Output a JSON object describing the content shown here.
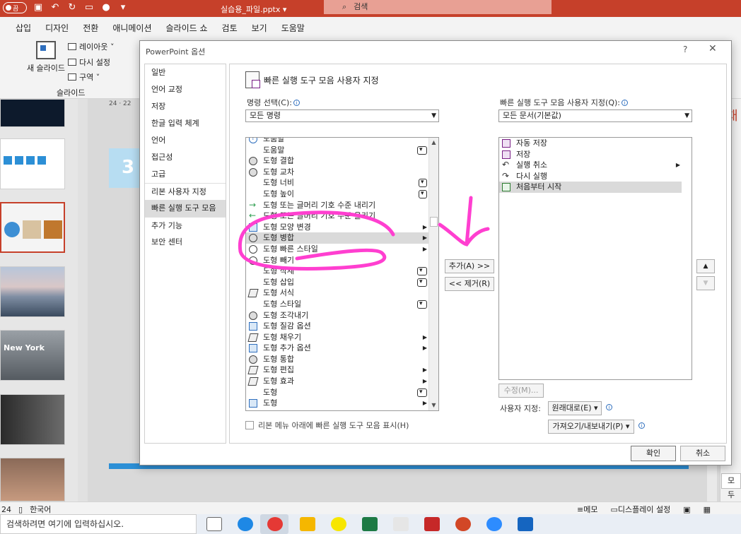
{
  "titlebar": {
    "autosave_label": "끔",
    "filename": "실습용_파일.pptx ▾",
    "search_placeholder": "검색"
  },
  "menu_tabs": [
    "삽입",
    "디자인",
    "전환",
    "애니메이션",
    "슬라이드 쇼",
    "검토",
    "보기",
    "도움말"
  ],
  "ribbon": {
    "new_slide": "새 슬라이드",
    "layout": "레이아웃 ˅",
    "reset": "다시 설정",
    "section": "구역 ˅",
    "group_label": "슬라이드"
  },
  "ruler_label": "24 · 22",
  "slide_partial_text": "3",
  "thumb_city_text": "New York",
  "right_pane_text": "채",
  "right_pane_button": "모두",
  "status": {
    "slide_num": "24",
    "language": "한국어",
    "notes": "메모",
    "display": "디스플레이 설정"
  },
  "taskbar": {
    "search_placeholder": "검색하려면 여기에 입력하십시오."
  },
  "dialog": {
    "title": "PowerPoint 옵션",
    "help": "?",
    "close": "✕",
    "nav_items": [
      {
        "label": "일반",
        "active": false
      },
      {
        "label": "언어 교정",
        "active": false
      },
      {
        "label": "저장",
        "active": false
      },
      {
        "label": "한글 입력 체계",
        "active": false
      },
      {
        "label": "언어",
        "active": false
      },
      {
        "label": "접근성",
        "active": false
      },
      {
        "label": "고급",
        "active": false
      },
      {
        "label": "리본 사용자 지정",
        "active": false
      },
      {
        "label": "빠른 실행 도구 모음",
        "active": true
      },
      {
        "label": "추가 기능",
        "active": false
      },
      {
        "label": "보안 센터",
        "active": false
      }
    ],
    "heading": "빠른 실행 도구 모음 사용자 지정",
    "choose_label": "명령 선택(C):",
    "choose_value": "모든 명령",
    "customize_label": "빠른 실행 도구 모음 사용자 지정(Q):",
    "customize_value": "모든 문서(기본값)",
    "commands": [
      {
        "label": "도움말",
        "icon": "question-icon",
        "tail": ""
      },
      {
        "label": "도움말",
        "icon": "",
        "tail": "opt"
      },
      {
        "label": "도형 결합",
        "icon": "combine-shapes-icon",
        "tail": ""
      },
      {
        "label": "도형 교차",
        "icon": "intersect-shapes-icon",
        "tail": ""
      },
      {
        "label": "도형 너비",
        "icon": "",
        "tail": "spin"
      },
      {
        "label": "도형 높이",
        "icon": "",
        "tail": "spin"
      },
      {
        "label": "도형 또는 글머리 기호 수준 내리기",
        "icon": "demote-arrow-icon",
        "tail": ""
      },
      {
        "label": "도형 또는 글머리 기호 수준 올리기",
        "icon": "promote-arrow-icon",
        "tail": ""
      },
      {
        "label": "도형 모양 변경",
        "icon": "change-shape-icon",
        "tail": "sub"
      },
      {
        "label": "도형 병합",
        "icon": "merge-shapes-icon",
        "tail": "sub",
        "selected": true
      },
      {
        "label": "도형 빠른 스타일",
        "icon": "quick-style-icon",
        "tail": "sub"
      },
      {
        "label": "도형 빼기",
        "icon": "subtract-shapes-icon",
        "tail": ""
      },
      {
        "label": "도형 삭제",
        "icon": "",
        "tail": "opt"
      },
      {
        "label": "도형 삽입",
        "icon": "",
        "tail": "opt"
      },
      {
        "label": "도형 서식",
        "icon": "format-shape-icon",
        "tail": ""
      },
      {
        "label": "도형 스타일",
        "icon": "",
        "tail": "opt"
      },
      {
        "label": "도형 조각내기",
        "icon": "fragment-shapes-icon",
        "tail": ""
      },
      {
        "label": "도형 질감 옵션",
        "icon": "texture-icon",
        "tail": ""
      },
      {
        "label": "도형 채우기",
        "icon": "fill-icon",
        "tail": "sub"
      },
      {
        "label": "도형 추가 옵션",
        "icon": "add-shape-icon",
        "tail": "sub"
      },
      {
        "label": "도형 통합",
        "icon": "union-shapes-icon",
        "tail": ""
      },
      {
        "label": "도형 편집",
        "icon": "edit-shape-icon",
        "tail": "sub"
      },
      {
        "label": "도형 효과",
        "icon": "shape-effects-icon",
        "tail": "sub"
      },
      {
        "label": "도형",
        "icon": "",
        "tail": "opt"
      },
      {
        "label": "도형",
        "icon": "shapes-icon",
        "tail": "sub"
      }
    ],
    "qat_items": [
      {
        "label": "자동 저장",
        "icon": "autosave-icon",
        "tail": ""
      },
      {
        "label": "저장",
        "icon": "save-icon",
        "tail": ""
      },
      {
        "label": "실행 취소",
        "icon": "undo-icon",
        "tail": "sub"
      },
      {
        "label": "다시 실행",
        "icon": "redo-icon",
        "tail": ""
      },
      {
        "label": "처음부터 시작",
        "icon": "start-from-beginning-icon",
        "tail": "",
        "selected": true
      }
    ],
    "add_button": "추가(A) >>",
    "remove_button": "<< 제거(R)",
    "modify_button": "수정(M)...",
    "custom_label": "사용자 지정:",
    "reset_button": "원래대로(E) ▾",
    "import_export_button": "가져오기/내보내기(P) ▾",
    "show_below_label": "리본 메뉴 아래에 빠른 실행 도구 모음 표시(H)",
    "ok": "확인",
    "cancel": "취소"
  },
  "colors": {
    "titlebar": "#c6402a",
    "annotation": "#ff3fd0",
    "selection": "#dadada"
  }
}
